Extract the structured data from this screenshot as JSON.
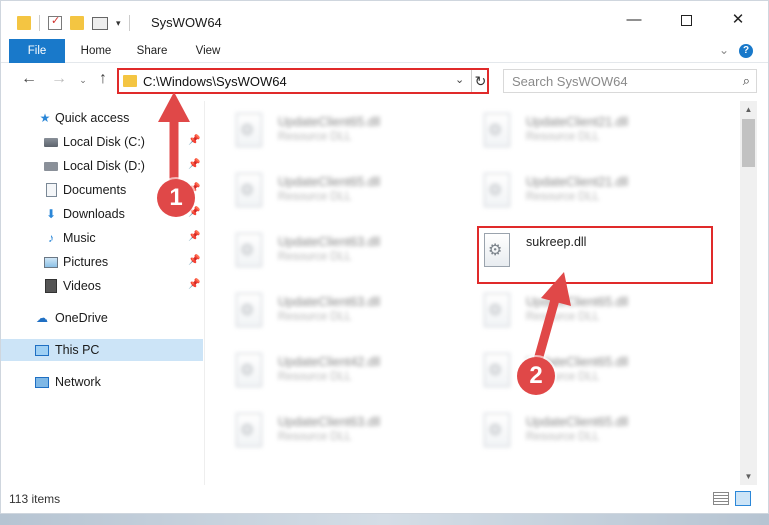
{
  "window": {
    "title": "SysWOW64",
    "controls": {
      "minimize": "—",
      "maximize": "",
      "close": "✕"
    }
  },
  "ribbon": {
    "tabs": [
      {
        "label": "File"
      },
      {
        "label": "Home"
      },
      {
        "label": "Share"
      },
      {
        "label": "View"
      }
    ],
    "help": "?"
  },
  "navigation": {
    "back": "←",
    "forward": "→",
    "up": "↑",
    "address": "C:\\Windows\\SysWOW64",
    "refresh": "↻",
    "search_placeholder": "Search SysWOW64",
    "search_icon": "⌕"
  },
  "sidebar": {
    "items": [
      {
        "label": "Quick access",
        "icon": "star-icon",
        "pinned": false
      },
      {
        "label": "Local Disk (C:)",
        "icon": "disk-icon",
        "pinned": true
      },
      {
        "label": "Local Disk (D:)",
        "icon": "disk-icon",
        "pinned": true
      },
      {
        "label": "Documents",
        "icon": "documents-icon",
        "pinned": true
      },
      {
        "label": "Downloads",
        "icon": "downloads-icon",
        "pinned": true
      },
      {
        "label": "Music",
        "icon": "music-icon",
        "pinned": true
      },
      {
        "label": "Pictures",
        "icon": "pictures-icon",
        "pinned": true
      },
      {
        "label": "Videos",
        "icon": "videos-icon",
        "pinned": true
      },
      {
        "label": "OneDrive",
        "icon": "onedrive-icon",
        "pinned": false
      },
      {
        "label": "This PC",
        "icon": "this-pc-icon",
        "pinned": false,
        "selected": true
      },
      {
        "label": "Network",
        "icon": "network-icon",
        "pinned": false
      }
    ]
  },
  "files": {
    "left_column": [
      {
        "name": "UpdateClient65.dll",
        "type": "Resource DLL"
      },
      {
        "name": "UpdateClient65.dll",
        "type": "Resource DLL"
      },
      {
        "name": "UpdateClient63.dll",
        "type": "Resource DLL"
      },
      {
        "name": "UpdateClient63.dll",
        "type": "Resource DLL"
      },
      {
        "name": "UpdateClient42.dll",
        "type": "Resource DLL"
      },
      {
        "name": "UpdateClient63.dll",
        "type": "Resource DLL"
      }
    ],
    "right_column": [
      {
        "name": "UpdateClient21.dll",
        "type": "Resource DLL"
      },
      {
        "name": "UpdateClient21.dll",
        "type": "Resource DLL"
      },
      {
        "name": "sukreep.dll",
        "type": ""
      },
      {
        "name": "UpdateClient65.dll",
        "type": "Resource DLL"
      },
      {
        "name": "UpdateClient65.dll",
        "type": "Resource DLL"
      },
      {
        "name": "UpdateClient65.dll",
        "type": "Resource DLL"
      }
    ]
  },
  "status": {
    "item_count": "113 items"
  },
  "annotations": {
    "step1": "1",
    "step2": "2",
    "accent_color": "#e02a2a"
  }
}
